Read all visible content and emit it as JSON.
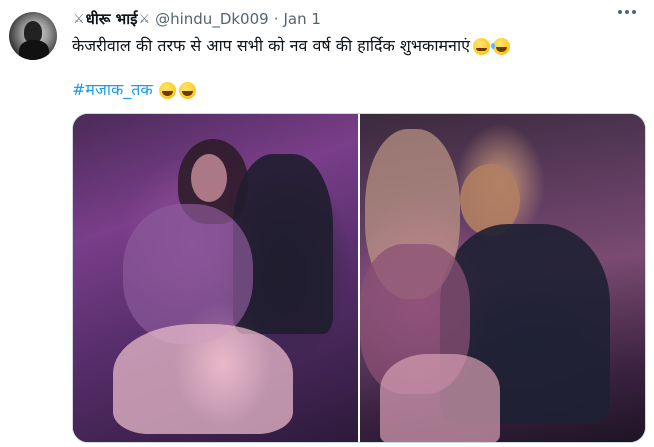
{
  "tweet": {
    "display_name": "धीरू भाई",
    "handle": "@hindu_Dk009",
    "separator": "·",
    "date": "Jan 1",
    "text": "केजरीवाल की तरफ से आप सभी को नव वर्ष की हार्दिक शुभकामनाएं",
    "hashtag": "#मजाक_तक",
    "sword_glyph": "⚔"
  },
  "icons": {
    "name_left": "crossed-swords-icon",
    "name_right": "crossed-swords-icon",
    "more": "more-horizontal-icon"
  },
  "colors": {
    "text": "#0f1419",
    "muted": "#536471",
    "link": "#1d9bf0",
    "border": "#cfd9de"
  }
}
